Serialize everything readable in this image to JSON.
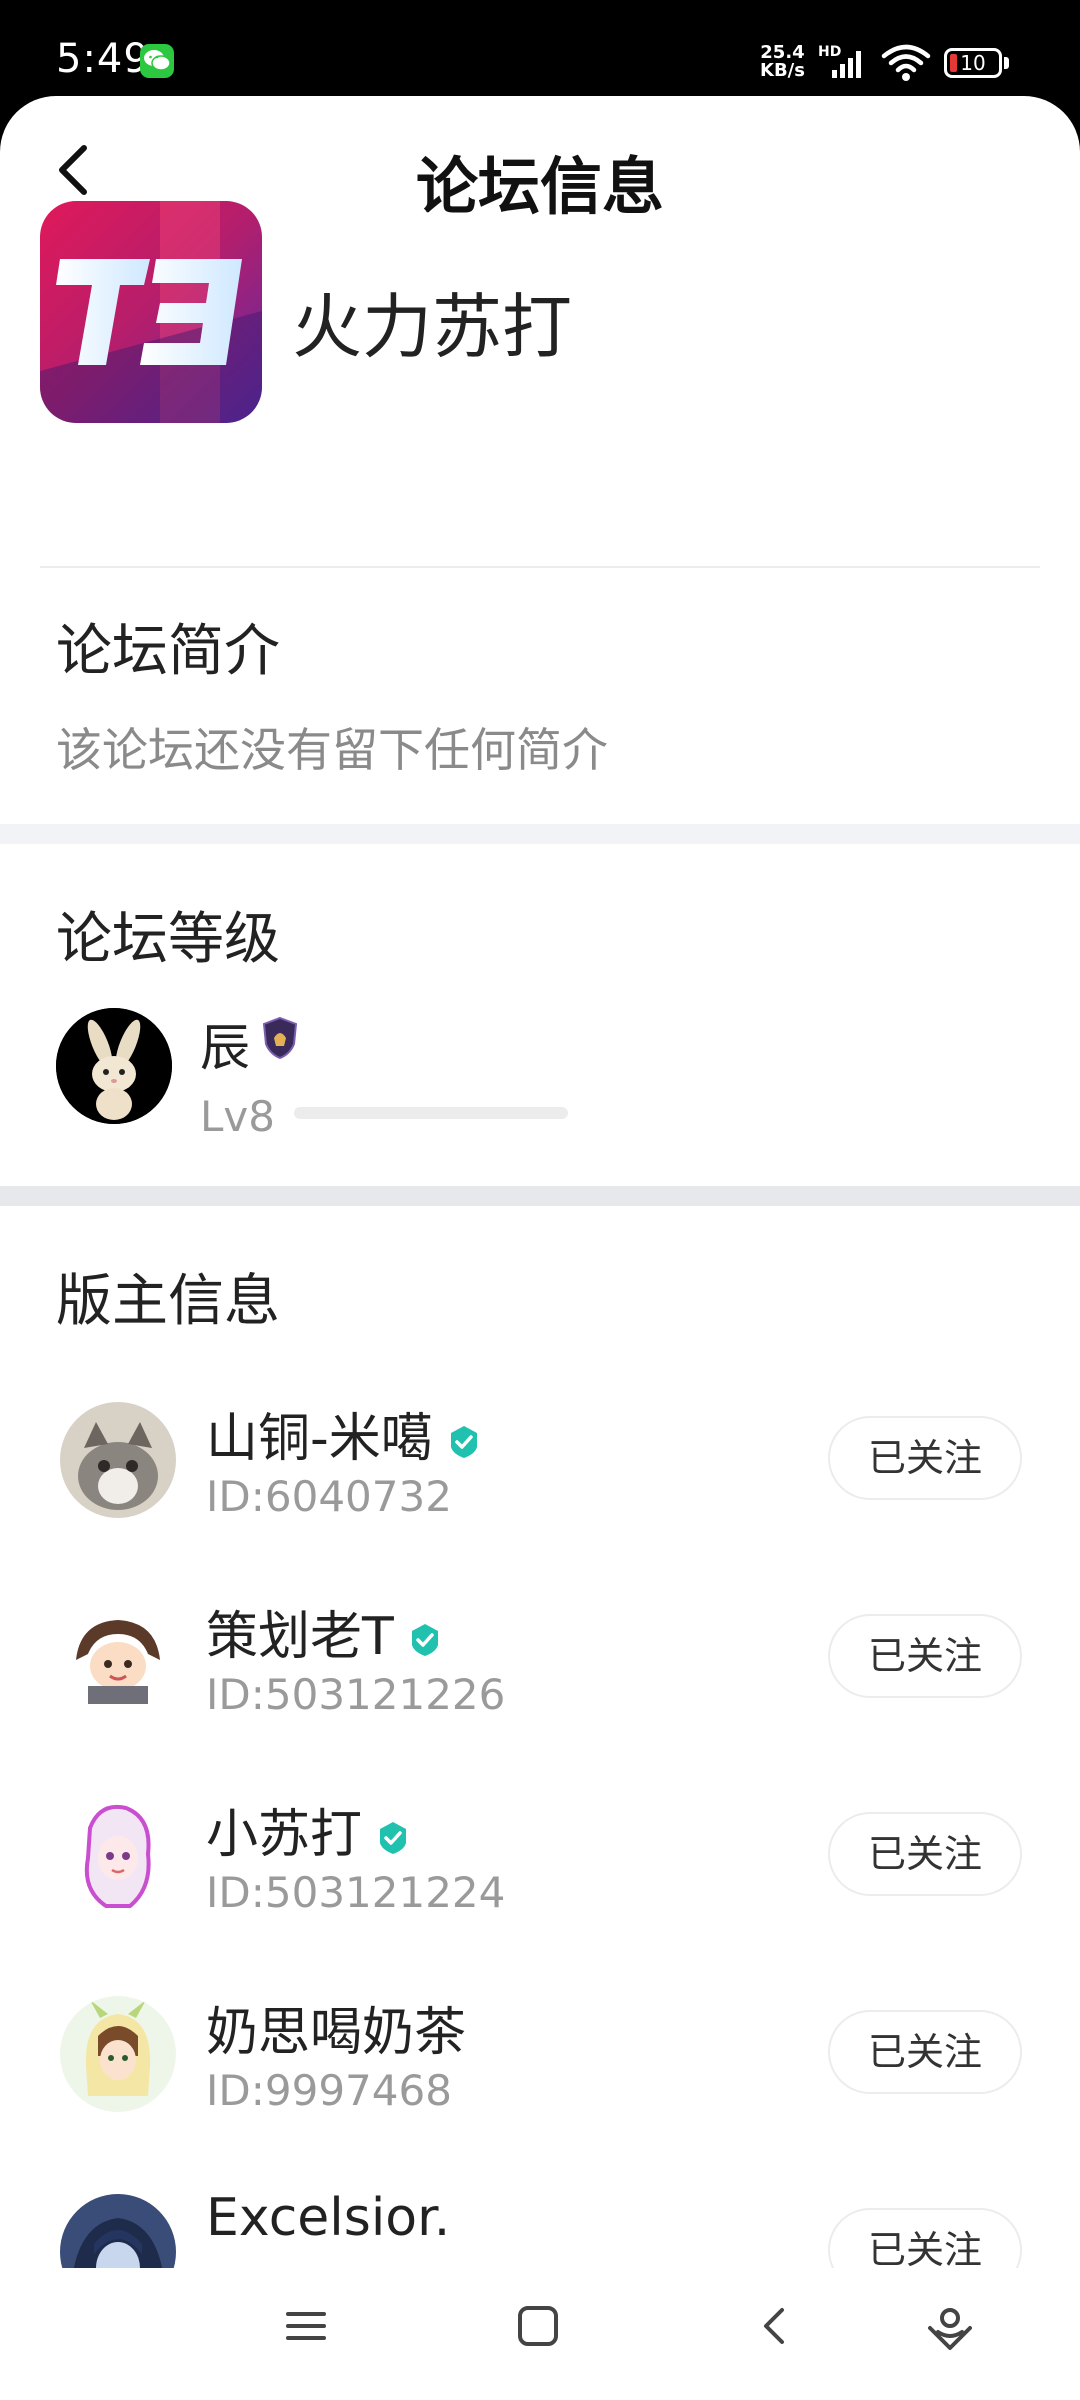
{
  "status_bar": {
    "time": "5:49",
    "net_speed_value": "25.4",
    "net_speed_unit": "KB/s",
    "hd_label": "HD",
    "battery_level": "10",
    "icons": [
      "wechat-icon",
      "signal-icon",
      "wifi-icon",
      "battery-icon"
    ]
  },
  "header": {
    "title": "论坛信息",
    "back_icon": "chevron-left-icon"
  },
  "forum": {
    "name": "火力苏打",
    "logo_text": "T3"
  },
  "intro": {
    "title": "论坛简介",
    "text": "该论坛还没有留下任何简介"
  },
  "level": {
    "title": "论坛等级",
    "user_name": "辰",
    "level_label": "Lv8",
    "progress": 0
  },
  "moderators": {
    "title": "版主信息",
    "follow_label": "已关注",
    "items": [
      {
        "name": "山铜-米噶",
        "id": "ID:6040732",
        "verified": true
      },
      {
        "name": "策划老T",
        "id": "ID:503121226",
        "verified": true
      },
      {
        "name": "小苏打",
        "id": "ID:503121224",
        "verified": true
      },
      {
        "name": "奶思喝奶茶",
        "id": "ID:9997468",
        "verified": false
      },
      {
        "name": "Excelsior.",
        "id": "",
        "verified": false
      }
    ]
  },
  "nav_bar": {
    "icons": [
      "menu-icon",
      "home-icon",
      "back-icon",
      "assistant-icon"
    ]
  },
  "colors": {
    "verified": "#21c1b0",
    "battery_low": "#e53935",
    "muted_text": "#9a9a9a",
    "band": "#f2f3f6"
  }
}
